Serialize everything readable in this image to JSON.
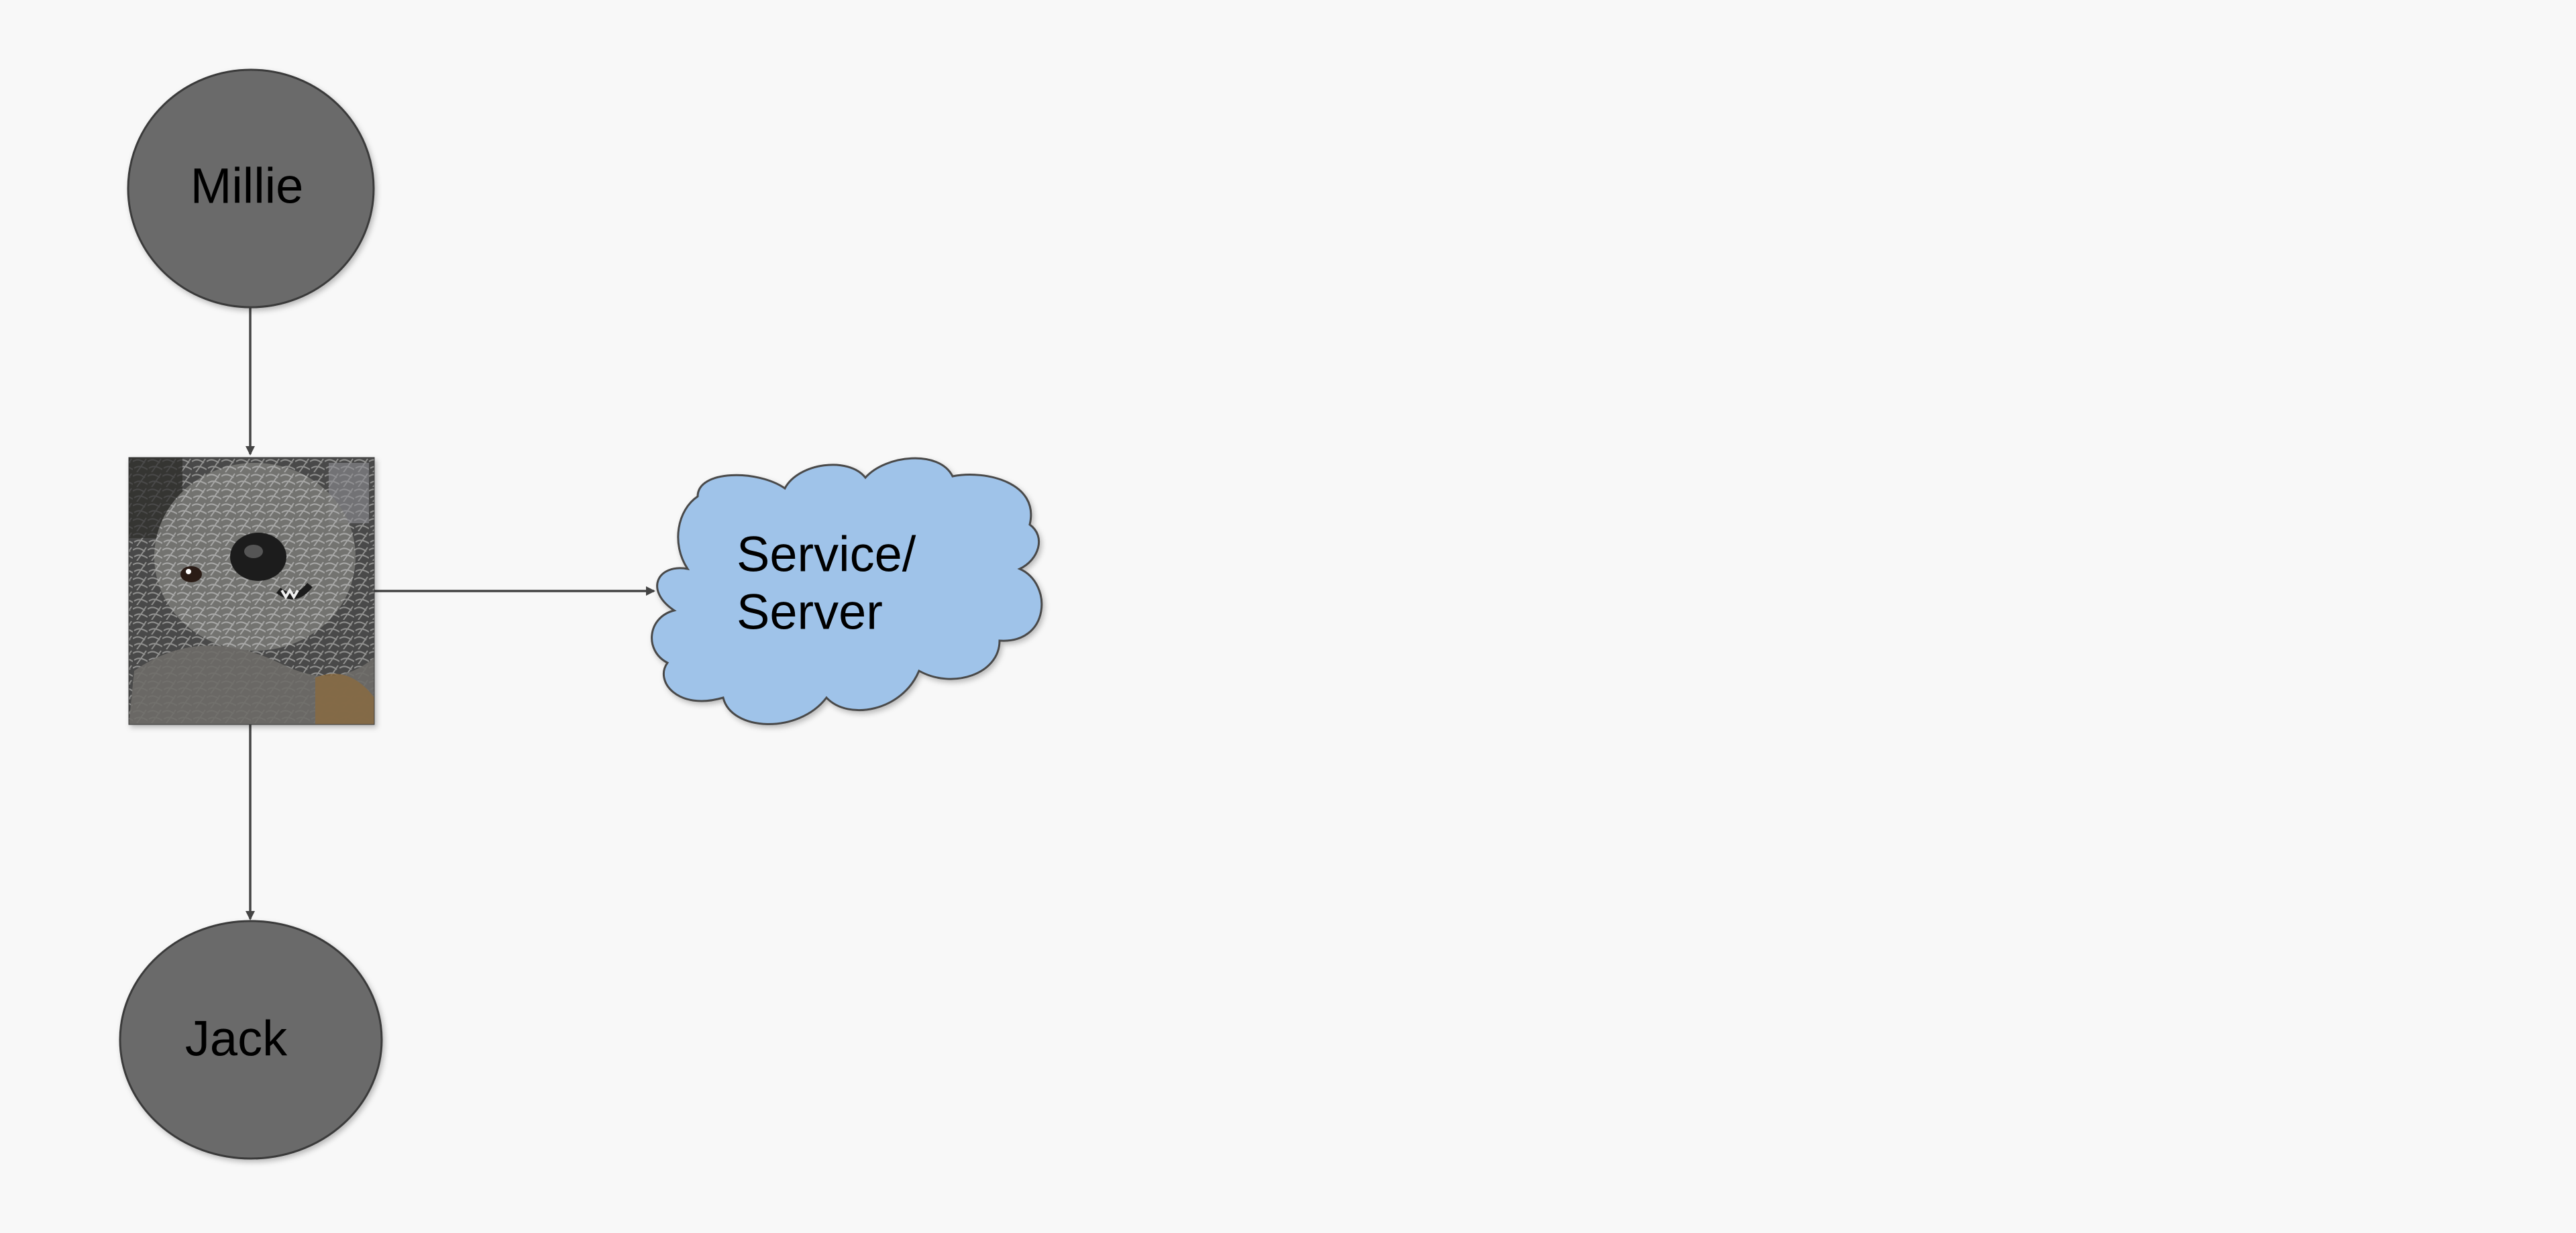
{
  "diagram": {
    "nodes": {
      "millie": {
        "label": "Millie"
      },
      "dog_photo": {
        "description_icon": "dog-photo-icon"
      },
      "service": {
        "label_line1": "Service/",
        "label_line2": "Server"
      },
      "jack": {
        "label": "Jack"
      }
    },
    "edges": [
      {
        "from": "millie",
        "to": "dog_photo"
      },
      {
        "from": "dog_photo",
        "to": "service"
      },
      {
        "from": "dog_photo",
        "to": "jack"
      }
    ],
    "colors": {
      "background": "#f8f8f8",
      "circle_fill": "#6b6b6b",
      "circle_stroke": "#3a3a3a",
      "cloud_fill": "#9fc3e9",
      "cloud_stroke": "#4a4a4a",
      "edge": "#444444"
    }
  }
}
